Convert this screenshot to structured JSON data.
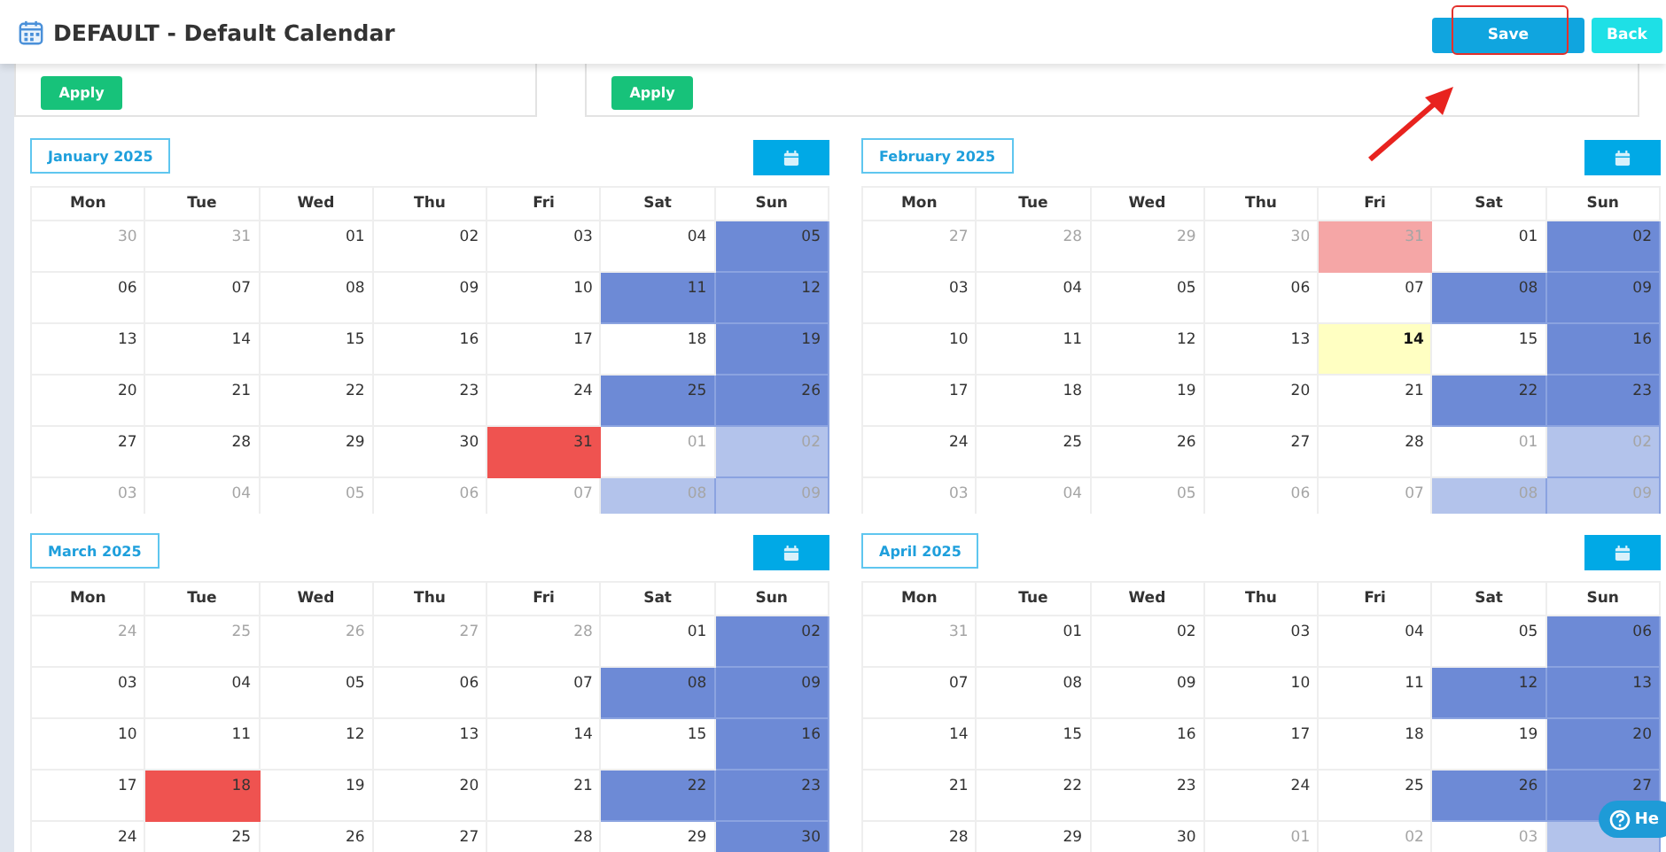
{
  "header": {
    "title": "DEFAULT - Default Calendar",
    "buttons": [
      {
        "label": "Save",
        "kind": "primary",
        "highlighted": true
      },
      {
        "label": "Back",
        "kind": "secondary",
        "highlighted": false
      }
    ]
  },
  "annotation_arrow": true,
  "filters": [
    {
      "button": "Apply"
    },
    {
      "button": "Apply"
    }
  ],
  "months": [
    {
      "title": "January 2025",
      "weekdays": [
        "Mon",
        "Tue",
        "Wed",
        "Thu",
        "Fri",
        "Sat",
        "Sun"
      ],
      "weeks": [
        [
          {
            "n": "30",
            "kind": "day",
            "outside": true
          },
          {
            "n": "31",
            "kind": "day",
            "outside": true
          },
          {
            "n": "01",
            "kind": "day",
            "outside": false
          },
          {
            "n": "02",
            "kind": "day",
            "outside": false
          },
          {
            "n": "03",
            "kind": "day",
            "outside": false
          },
          {
            "n": "04",
            "kind": "day",
            "outside": false
          },
          {
            "n": "05",
            "kind": "weekend",
            "outside": false
          }
        ],
        [
          {
            "n": "06",
            "kind": "day",
            "outside": false
          },
          {
            "n": "07",
            "kind": "day",
            "outside": false
          },
          {
            "n": "08",
            "kind": "day",
            "outside": false
          },
          {
            "n": "09",
            "kind": "day",
            "outside": false
          },
          {
            "n": "10",
            "kind": "day",
            "outside": false
          },
          {
            "n": "11",
            "kind": "weekend",
            "outside": false
          },
          {
            "n": "12",
            "kind": "weekend",
            "outside": false
          }
        ],
        [
          {
            "n": "13",
            "kind": "day",
            "outside": false
          },
          {
            "n": "14",
            "kind": "day",
            "outside": false
          },
          {
            "n": "15",
            "kind": "day",
            "outside": false
          },
          {
            "n": "16",
            "kind": "day",
            "outside": false
          },
          {
            "n": "17",
            "kind": "day",
            "outside": false
          },
          {
            "n": "18",
            "kind": "day",
            "outside": false
          },
          {
            "n": "19",
            "kind": "weekend",
            "outside": false
          }
        ],
        [
          {
            "n": "20",
            "kind": "day",
            "outside": false
          },
          {
            "n": "21",
            "kind": "day",
            "outside": false
          },
          {
            "n": "22",
            "kind": "day",
            "outside": false
          },
          {
            "n": "23",
            "kind": "day",
            "outside": false
          },
          {
            "n": "24",
            "kind": "day",
            "outside": false
          },
          {
            "n": "25",
            "kind": "weekend",
            "outside": false
          },
          {
            "n": "26",
            "kind": "weekend",
            "outside": false
          }
        ],
        [
          {
            "n": "27",
            "kind": "day",
            "outside": false
          },
          {
            "n": "28",
            "kind": "day",
            "outside": false
          },
          {
            "n": "29",
            "kind": "day",
            "outside": false
          },
          {
            "n": "30",
            "kind": "day",
            "outside": false
          },
          {
            "n": "31",
            "kind": "holiday",
            "outside": false
          },
          {
            "n": "01",
            "kind": "day",
            "outside": true
          },
          {
            "n": "02",
            "kind": "weekend",
            "outside": true
          }
        ],
        [
          {
            "n": "03",
            "kind": "day",
            "outside": true
          },
          {
            "n": "04",
            "kind": "day",
            "outside": true
          },
          {
            "n": "05",
            "kind": "day",
            "outside": true
          },
          {
            "n": "06",
            "kind": "day",
            "outside": true
          },
          {
            "n": "07",
            "kind": "day",
            "outside": true
          },
          {
            "n": "08",
            "kind": "weekend",
            "outside": true
          },
          {
            "n": "09",
            "kind": "weekend",
            "outside": true
          }
        ]
      ]
    },
    {
      "title": "February 2025",
      "weekdays": [
        "Mon",
        "Tue",
        "Wed",
        "Thu",
        "Fri",
        "Sat",
        "Sun"
      ],
      "weeks": [
        [
          {
            "n": "27",
            "kind": "day",
            "outside": true
          },
          {
            "n": "28",
            "kind": "day",
            "outside": true
          },
          {
            "n": "29",
            "kind": "day",
            "outside": true
          },
          {
            "n": "30",
            "kind": "day",
            "outside": true
          },
          {
            "n": "31",
            "kind": "holiday",
            "outside": true
          },
          {
            "n": "01",
            "kind": "day",
            "outside": false
          },
          {
            "n": "02",
            "kind": "weekend",
            "outside": false
          }
        ],
        [
          {
            "n": "03",
            "kind": "day",
            "outside": false
          },
          {
            "n": "04",
            "kind": "day",
            "outside": false
          },
          {
            "n": "05",
            "kind": "day",
            "outside": false
          },
          {
            "n": "06",
            "kind": "day",
            "outside": false
          },
          {
            "n": "07",
            "kind": "day",
            "outside": false
          },
          {
            "n": "08",
            "kind": "weekend",
            "outside": false
          },
          {
            "n": "09",
            "kind": "weekend",
            "outside": false
          }
        ],
        [
          {
            "n": "10",
            "kind": "day",
            "outside": false
          },
          {
            "n": "11",
            "kind": "day",
            "outside": false
          },
          {
            "n": "12",
            "kind": "day",
            "outside": false
          },
          {
            "n": "13",
            "kind": "day",
            "outside": false
          },
          {
            "n": "14",
            "kind": "today",
            "outside": false
          },
          {
            "n": "15",
            "kind": "day",
            "outside": false
          },
          {
            "n": "16",
            "kind": "weekend",
            "outside": false
          }
        ],
        [
          {
            "n": "17",
            "kind": "day",
            "outside": false
          },
          {
            "n": "18",
            "kind": "day",
            "outside": false
          },
          {
            "n": "19",
            "kind": "day",
            "outside": false
          },
          {
            "n": "20",
            "kind": "day",
            "outside": false
          },
          {
            "n": "21",
            "kind": "day",
            "outside": false
          },
          {
            "n": "22",
            "kind": "weekend",
            "outside": false
          },
          {
            "n": "23",
            "kind": "weekend",
            "outside": false
          }
        ],
        [
          {
            "n": "24",
            "kind": "day",
            "outside": false
          },
          {
            "n": "25",
            "kind": "day",
            "outside": false
          },
          {
            "n": "26",
            "kind": "day",
            "outside": false
          },
          {
            "n": "27",
            "kind": "day",
            "outside": false
          },
          {
            "n": "28",
            "kind": "day",
            "outside": false
          },
          {
            "n": "01",
            "kind": "day",
            "outside": true
          },
          {
            "n": "02",
            "kind": "weekend",
            "outside": true
          }
        ],
        [
          {
            "n": "03",
            "kind": "day",
            "outside": true
          },
          {
            "n": "04",
            "kind": "day",
            "outside": true
          },
          {
            "n": "05",
            "kind": "day",
            "outside": true
          },
          {
            "n": "06",
            "kind": "day",
            "outside": true
          },
          {
            "n": "07",
            "kind": "day",
            "outside": true
          },
          {
            "n": "08",
            "kind": "weekend",
            "outside": true
          },
          {
            "n": "09",
            "kind": "weekend",
            "outside": true
          }
        ]
      ]
    },
    {
      "title": "March 2025",
      "weekdays": [
        "Mon",
        "Tue",
        "Wed",
        "Thu",
        "Fri",
        "Sat",
        "Sun"
      ],
      "weeks": [
        [
          {
            "n": "24",
            "kind": "day",
            "outside": true
          },
          {
            "n": "25",
            "kind": "day",
            "outside": true
          },
          {
            "n": "26",
            "kind": "day",
            "outside": true
          },
          {
            "n": "27",
            "kind": "day",
            "outside": true
          },
          {
            "n": "28",
            "kind": "day",
            "outside": true
          },
          {
            "n": "01",
            "kind": "day",
            "outside": false
          },
          {
            "n": "02",
            "kind": "weekend",
            "outside": false
          }
        ],
        [
          {
            "n": "03",
            "kind": "day",
            "outside": false
          },
          {
            "n": "04",
            "kind": "day",
            "outside": false
          },
          {
            "n": "05",
            "kind": "day",
            "outside": false
          },
          {
            "n": "06",
            "kind": "day",
            "outside": false
          },
          {
            "n": "07",
            "kind": "day",
            "outside": false
          },
          {
            "n": "08",
            "kind": "weekend",
            "outside": false
          },
          {
            "n": "09",
            "kind": "weekend",
            "outside": false
          }
        ],
        [
          {
            "n": "10",
            "kind": "day",
            "outside": false
          },
          {
            "n": "11",
            "kind": "day",
            "outside": false
          },
          {
            "n": "12",
            "kind": "day",
            "outside": false
          },
          {
            "n": "13",
            "kind": "day",
            "outside": false
          },
          {
            "n": "14",
            "kind": "day",
            "outside": false
          },
          {
            "n": "15",
            "kind": "day",
            "outside": false
          },
          {
            "n": "16",
            "kind": "weekend",
            "outside": false
          }
        ],
        [
          {
            "n": "17",
            "kind": "day",
            "outside": false
          },
          {
            "n": "18",
            "kind": "holiday",
            "outside": false
          },
          {
            "n": "19",
            "kind": "day",
            "outside": false
          },
          {
            "n": "20",
            "kind": "day",
            "outside": false
          },
          {
            "n": "21",
            "kind": "day",
            "outside": false
          },
          {
            "n": "22",
            "kind": "weekend",
            "outside": false
          },
          {
            "n": "23",
            "kind": "weekend",
            "outside": false
          }
        ],
        [
          {
            "n": "24",
            "kind": "day",
            "outside": false
          },
          {
            "n": "25",
            "kind": "day",
            "outside": false
          },
          {
            "n": "26",
            "kind": "day",
            "outside": false
          },
          {
            "n": "27",
            "kind": "day",
            "outside": false
          },
          {
            "n": "28",
            "kind": "day",
            "outside": false
          },
          {
            "n": "29",
            "kind": "day",
            "outside": false
          },
          {
            "n": "30",
            "kind": "weekend",
            "outside": false
          }
        ]
      ]
    },
    {
      "title": "April 2025",
      "weekdays": [
        "Mon",
        "Tue",
        "Wed",
        "Thu",
        "Fri",
        "Sat",
        "Sun"
      ],
      "weeks": [
        [
          {
            "n": "31",
            "kind": "day",
            "outside": true
          },
          {
            "n": "01",
            "kind": "day",
            "outside": false
          },
          {
            "n": "02",
            "kind": "day",
            "outside": false
          },
          {
            "n": "03",
            "kind": "day",
            "outside": false
          },
          {
            "n": "04",
            "kind": "day",
            "outside": false
          },
          {
            "n": "05",
            "kind": "day",
            "outside": false
          },
          {
            "n": "06",
            "kind": "weekend",
            "outside": false
          }
        ],
        [
          {
            "n": "07",
            "kind": "day",
            "outside": false
          },
          {
            "n": "08",
            "kind": "day",
            "outside": false
          },
          {
            "n": "09",
            "kind": "day",
            "outside": false
          },
          {
            "n": "10",
            "kind": "day",
            "outside": false
          },
          {
            "n": "11",
            "kind": "day",
            "outside": false
          },
          {
            "n": "12",
            "kind": "weekend",
            "outside": false
          },
          {
            "n": "13",
            "kind": "weekend",
            "outside": false
          }
        ],
        [
          {
            "n": "14",
            "kind": "day",
            "outside": false
          },
          {
            "n": "15",
            "kind": "day",
            "outside": false
          },
          {
            "n": "16",
            "kind": "day",
            "outside": false
          },
          {
            "n": "17",
            "kind": "day",
            "outside": false
          },
          {
            "n": "18",
            "kind": "day",
            "outside": false
          },
          {
            "n": "19",
            "kind": "day",
            "outside": false
          },
          {
            "n": "20",
            "kind": "weekend",
            "outside": false
          }
        ],
        [
          {
            "n": "21",
            "kind": "day",
            "outside": false
          },
          {
            "n": "22",
            "kind": "day",
            "outside": false
          },
          {
            "n": "23",
            "kind": "day",
            "outside": false
          },
          {
            "n": "24",
            "kind": "day",
            "outside": false
          },
          {
            "n": "25",
            "kind": "day",
            "outside": false
          },
          {
            "n": "26",
            "kind": "weekend",
            "outside": false
          },
          {
            "n": "27",
            "kind": "weekend",
            "outside": false
          }
        ],
        [
          {
            "n": "28",
            "kind": "day",
            "outside": false
          },
          {
            "n": "29",
            "kind": "day",
            "outside": false
          },
          {
            "n": "30",
            "kind": "day",
            "outside": false
          },
          {
            "n": "01",
            "kind": "day",
            "outside": true
          },
          {
            "n": "02",
            "kind": "day",
            "outside": true
          },
          {
            "n": "03",
            "kind": "day",
            "outside": true
          },
          {
            "kind": "weekend",
            "outside": true
          }
        ]
      ]
    }
  ],
  "help_button": {
    "label": "He"
  }
}
